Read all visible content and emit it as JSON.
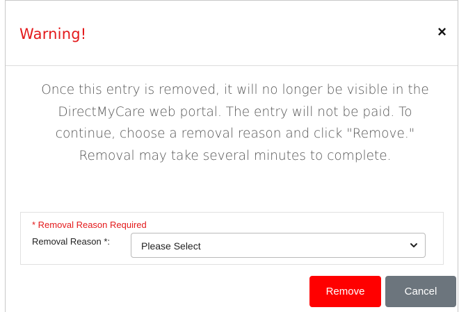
{
  "dialog": {
    "title": "Warning!",
    "close_label": "×",
    "message": "Once this entry is removed, it will no longer be visible in the DirectMyCare web portal. The entry will not be paid. To continue, choose a removal reason and click \"Remove.\" Removal may take several minutes to complete."
  },
  "form": {
    "required_note": "* Removal Reason Required",
    "removal_reason_label": "Removal Reason *:",
    "removal_reason_value": "Please Select"
  },
  "buttons": {
    "remove_label": "Remove",
    "cancel_label": "Cancel"
  },
  "colors": {
    "warning": "#e3191b",
    "remove_button": "#ff0000",
    "cancel_button": "#6c757d"
  }
}
